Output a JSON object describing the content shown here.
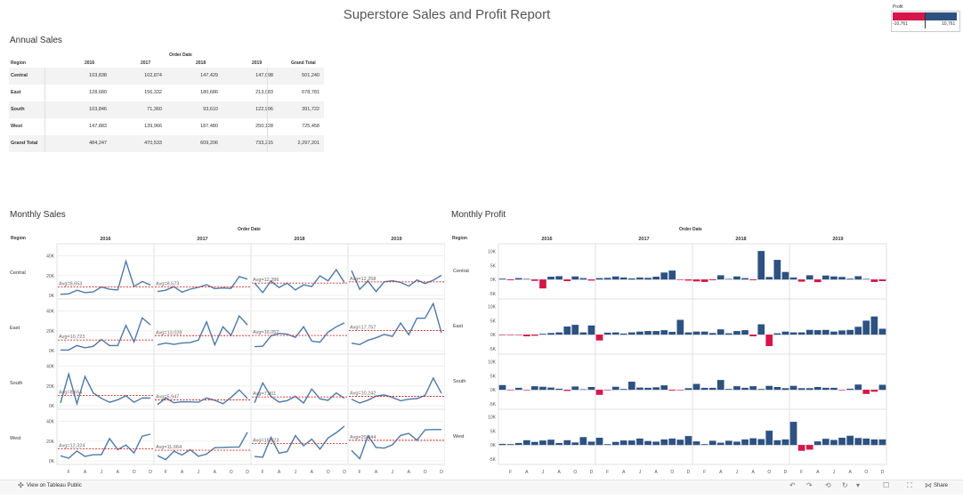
{
  "title": "Superstore Sales and Profit Report",
  "legend": {
    "label": "Profit",
    "min_label": "-10,761",
    "max_label": "10,761",
    "neg_color": "#d6164a",
    "pos_color": "#2d5282"
  },
  "annual_sales": {
    "title": "Annual Sales",
    "column_header": "Order Date",
    "row_header": "Region",
    "columns": [
      "2016",
      "2017",
      "2018",
      "2019",
      "Grand Total"
    ],
    "rows": [
      {
        "label": "Central",
        "values": [
          "103,838",
          "102,874",
          "147,429",
          "147,098",
          "501,240"
        ]
      },
      {
        "label": "East",
        "values": [
          "128,680",
          "156,332",
          "180,686",
          "213,083",
          "678,781"
        ]
      },
      {
        "label": "South",
        "values": [
          "103,846",
          "71,360",
          "93,610",
          "122,906",
          "391,722"
        ]
      },
      {
        "label": "West",
        "values": [
          "147,883",
          "139,966",
          "187,480",
          "250,128",
          "725,458"
        ]
      },
      {
        "label": "Grand Total",
        "values": [
          "484,247",
          "470,533",
          "609,206",
          "733,215",
          "2,297,201"
        ]
      }
    ]
  },
  "monthly_sales": {
    "title": "Monthly Sales",
    "column_header": "Order Date",
    "row_header": "Region",
    "years": [
      "2016",
      "2017",
      "2018",
      "2019"
    ],
    "month_ticks": [
      "F",
      "A",
      "J",
      "A",
      "O",
      "D"
    ],
    "y_ticks": [
      "40K",
      "20K",
      "0K"
    ],
    "regions": [
      {
        "label": "Central",
        "avgs": [
          "Avg=8,653",
          "Avg=8,573",
          "Avg=12,286",
          "Avg=12,258"
        ]
      },
      {
        "label": "East",
        "avgs": [
          "Avg=10,723",
          "Avg=13,028",
          "Avg=16,057",
          "Avg=17,757"
        ]
      },
      {
        "label": "South",
        "avgs": [
          "Avg=8,654",
          "Avg=5,947",
          "Avg=7,801",
          "Avg=10,242"
        ]
      },
      {
        "label": "West",
        "avgs": [
          "Avg=12,324",
          "Avg=11,664",
          "Avg=15,623",
          "Avg=20,844"
        ]
      }
    ]
  },
  "monthly_profit": {
    "title": "Monthly Profit",
    "column_header": "Order Date",
    "row_header": "Region",
    "years": [
      "2016",
      "2017",
      "2018",
      "2019"
    ],
    "month_ticks": [
      "F",
      "A",
      "J",
      "A",
      "O",
      "D"
    ],
    "y_ticks": [
      "10K",
      "5K",
      "0K",
      "-5K"
    ],
    "regions": [
      {
        "label": "Central"
      },
      {
        "label": "East"
      },
      {
        "label": "South"
      },
      {
        "label": "West"
      }
    ]
  },
  "chart_data": [
    {
      "type": "line",
      "title": "Monthly Sales",
      "ylim": [
        0,
        45000
      ],
      "reference_line": "average per year",
      "series": [
        {
          "name": "Central",
          "values": [
            1200,
            1500,
            5200,
            2800,
            3500,
            8500,
            6200,
            5500,
            34500,
            9000,
            14000,
            10500,
            4000,
            5200,
            8800,
            3300,
            6300,
            8100,
            10800,
            6800,
            7500,
            7000,
            19000,
            16500,
            12500,
            2800,
            14500,
            7900,
            12400,
            5500,
            10700,
            8900,
            19800,
            14700,
            26000,
            13000,
            25000,
            6200,
            14600,
            3900,
            13700,
            14800,
            13100,
            9400,
            15600,
            12000,
            15300,
            20300
          ]
        },
        {
          "name": "East",
          "values": [
            500,
            600,
            5000,
            2800,
            4200,
            11200,
            5000,
            5000,
            25500,
            8700,
            33000,
            26000,
            5800,
            7600,
            6200,
            7600,
            8000,
            10500,
            29000,
            5800,
            24000,
            15300,
            35000,
            26000,
            4000,
            4300,
            14800,
            17400,
            16600,
            13300,
            24000,
            9500,
            8500,
            18600,
            24000,
            28000,
            7500,
            6000,
            10400,
            12900,
            16300,
            14300,
            27800,
            16000,
            32800,
            32700,
            47500,
            18000
          ]
        },
        {
          "name": "South",
          "values": [
            2700,
            32000,
            2000,
            29500,
            13000,
            7500,
            3400,
            6000,
            10000,
            3500,
            7800,
            7700,
            1100,
            7700,
            3000,
            4000,
            3900,
            3500,
            7800,
            5500,
            2000,
            8400,
            16000,
            7400,
            3000,
            23000,
            9400,
            3600,
            5100,
            9500,
            2700,
            16800,
            6900,
            5400,
            13000,
            7500,
            6500,
            2700,
            5600,
            9700,
            10900,
            8400,
            5000,
            6600,
            7200,
            10400,
            28000,
            12500
          ]
        },
        {
          "name": "West",
          "values": [
            5100,
            2700,
            10000,
            4500,
            6200,
            6200,
            22500,
            11400,
            16000,
            8000,
            25000,
            27000,
            5300,
            1300,
            9700,
            5900,
            11300,
            4700,
            6800,
            13300,
            13600,
            13900,
            14000,
            29000,
            4400,
            3700,
            23800,
            7800,
            9400,
            25500,
            15300,
            22000,
            11900,
            23100,
            28400,
            35000,
            10500,
            2200,
            25200,
            13600,
            12900,
            16200,
            25700,
            27800,
            20900,
            31300,
            31700,
            31700
          ]
        }
      ]
    },
    {
      "type": "bar",
      "title": "Monthly Profit",
      "ylim": [
        -6000,
        11500
      ],
      "series": [
        {
          "name": "Central",
          "values": [
            300,
            -300,
            500,
            200,
            -500,
            -3200,
            1000,
            1200,
            -600,
            1100,
            500,
            -400,
            500,
            600,
            1100,
            700,
            400,
            700,
            600,
            1000,
            2500,
            3200,
            -200,
            -400,
            -700,
            -900,
            -300,
            1500,
            200,
            1100,
            500,
            -300,
            10200,
            900,
            7000,
            2700,
            700,
            -800,
            1500,
            -1000,
            1400,
            1100,
            900,
            300,
            1200,
            200,
            -900,
            -600
          ]
        },
        {
          "name": "East",
          "values": [
            -100,
            -100,
            -200,
            -600,
            -400,
            300,
            600,
            800,
            2900,
            3500,
            800,
            3300,
            -2100,
            700,
            800,
            400,
            800,
            1100,
            1300,
            1300,
            1600,
            1000,
            5300,
            800,
            1100,
            1100,
            600,
            1900,
            500,
            1300,
            1600,
            -600,
            3700,
            -4100,
            500,
            1100,
            800,
            800,
            1700,
            1600,
            1700,
            1100,
            1500,
            1700,
            2800,
            5000,
            6500,
            2100
          ]
        },
        {
          "name": "South",
          "values": [
            1700,
            -100,
            700,
            -200,
            1300,
            1100,
            800,
            400,
            -400,
            1200,
            200,
            1000,
            -1800,
            -100,
            1100,
            300,
            2900,
            800,
            700,
            900,
            1600,
            -300,
            -200,
            600,
            2100,
            700,
            700,
            3500,
            300,
            1300,
            700,
            1300,
            300,
            1400,
            1000,
            600,
            1400,
            600,
            600,
            1000,
            700,
            700,
            -200,
            400,
            1900,
            -1500,
            -700,
            1800
          ]
        },
        {
          "name": "West",
          "values": [
            400,
            300,
            700,
            1700,
            1100,
            1600,
            1900,
            700,
            1700,
            900,
            2800,
            1200,
            2600,
            300,
            1100,
            1600,
            1600,
            2300,
            1400,
            1200,
            2000,
            2300,
            1900,
            3200,
            1300,
            300,
            1500,
            800,
            1500,
            1200,
            2000,
            2400,
            2100,
            5100,
            1700,
            2000,
            8300,
            -2100,
            -1700,
            1300,
            2200,
            1800,
            2600,
            3300,
            2500,
            2300,
            2000,
            2000
          ]
        }
      ]
    }
  ],
  "footer": {
    "view_label": "View on Tableau Public",
    "share_label": "Share"
  }
}
